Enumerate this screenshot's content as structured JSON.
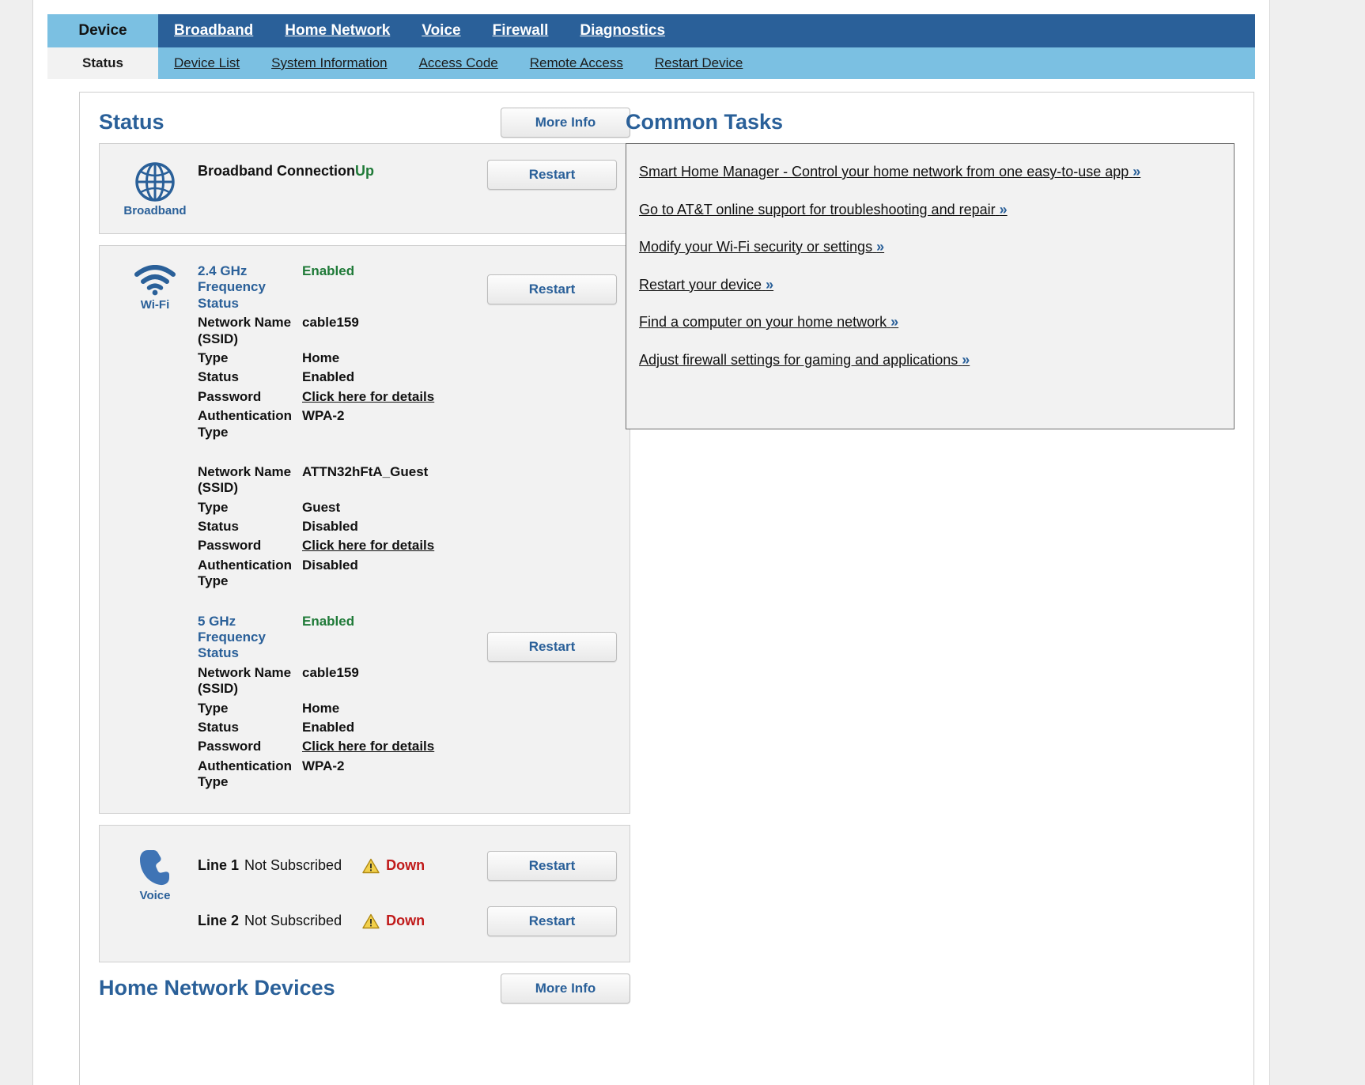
{
  "nav": {
    "primary": [
      {
        "label": "Device",
        "active": true
      },
      {
        "label": "Broadband",
        "active": false
      },
      {
        "label": "Home Network",
        "active": false
      },
      {
        "label": "Voice",
        "active": false
      },
      {
        "label": "Firewall",
        "active": false
      },
      {
        "label": "Diagnostics",
        "active": false
      }
    ],
    "secondary": [
      {
        "label": "Status",
        "active": true
      },
      {
        "label": "Device List",
        "active": false
      },
      {
        "label": "System Information",
        "active": false
      },
      {
        "label": "Access Code",
        "active": false
      },
      {
        "label": "Remote Access",
        "active": false
      },
      {
        "label": "Restart Device",
        "active": false
      }
    ]
  },
  "status": {
    "title": "Status",
    "more_info_label": "More Info",
    "broadband": {
      "icon_label": "Broadband",
      "title": "Broadband Connection",
      "state": "Up",
      "restart_label": "Restart"
    },
    "wifi": {
      "icon_label": "Wi-Fi",
      "restart_label_24": "Restart",
      "restart_label_5": "Restart",
      "band_24": {
        "head_key": "2.4 GHz Frequency Status",
        "head_value": "Enabled",
        "networks": [
          {
            "ssid_key": "Network Name (SSID)",
            "ssid_value": "cable159",
            "type_key": "Type",
            "type_value": "Home",
            "status_key": "Status",
            "status_value": "Enabled",
            "password_key": "Password",
            "password_value": "Click here for details",
            "auth_key": "Authentication Type",
            "auth_value": "WPA-2"
          },
          {
            "ssid_key": "Network Name (SSID)",
            "ssid_value": "ATTN32hFtA_Guest",
            "type_key": "Type",
            "type_value": "Guest",
            "status_key": "Status",
            "status_value": "Disabled",
            "password_key": "Password",
            "password_value": "Click here for details",
            "auth_key": "Authentication Type",
            "auth_value": "Disabled"
          }
        ]
      },
      "band_5": {
        "head_key": "5 GHz Frequency Status",
        "head_value": "Enabled",
        "networks": [
          {
            "ssid_key": "Network Name (SSID)",
            "ssid_value": "cable159",
            "type_key": "Type",
            "type_value": "Home",
            "status_key": "Status",
            "status_value": "Enabled",
            "password_key": "Password",
            "password_value": "Click here for details",
            "auth_key": "Authentication Type",
            "auth_value": "WPA-2"
          }
        ]
      }
    },
    "voice": {
      "icon_label": "Voice",
      "lines": [
        {
          "label": "Line 1",
          "subscription": "Not Subscribed",
          "state": "Down",
          "restart_label": "Restart"
        },
        {
          "label": "Line 2",
          "subscription": "Not Subscribed",
          "state": "Down",
          "restart_label": "Restart"
        }
      ]
    },
    "home_network_devices": {
      "title": "Home Network Devices",
      "more_info_label": "More Info"
    }
  },
  "common_tasks": {
    "title": "Common Tasks",
    "links": [
      "Smart Home Manager - Control your home network from one easy-to-use app",
      "Go to AT&T online support for troubleshooting and repair",
      "Modify your Wi-Fi security or settings",
      "Restart your device",
      "Find a computer on your home network",
      "Adjust firewall settings for gaming and applications"
    ],
    "chevron": "»"
  },
  "colors": {
    "primary_nav": "#2a6099",
    "secondary_nav": "#7bc0e2",
    "accent_blue": "#2a6099",
    "status_up_green": "#1f7a38",
    "status_down_red": "#c01a1a",
    "panel_bg": "#f2f2f2"
  }
}
